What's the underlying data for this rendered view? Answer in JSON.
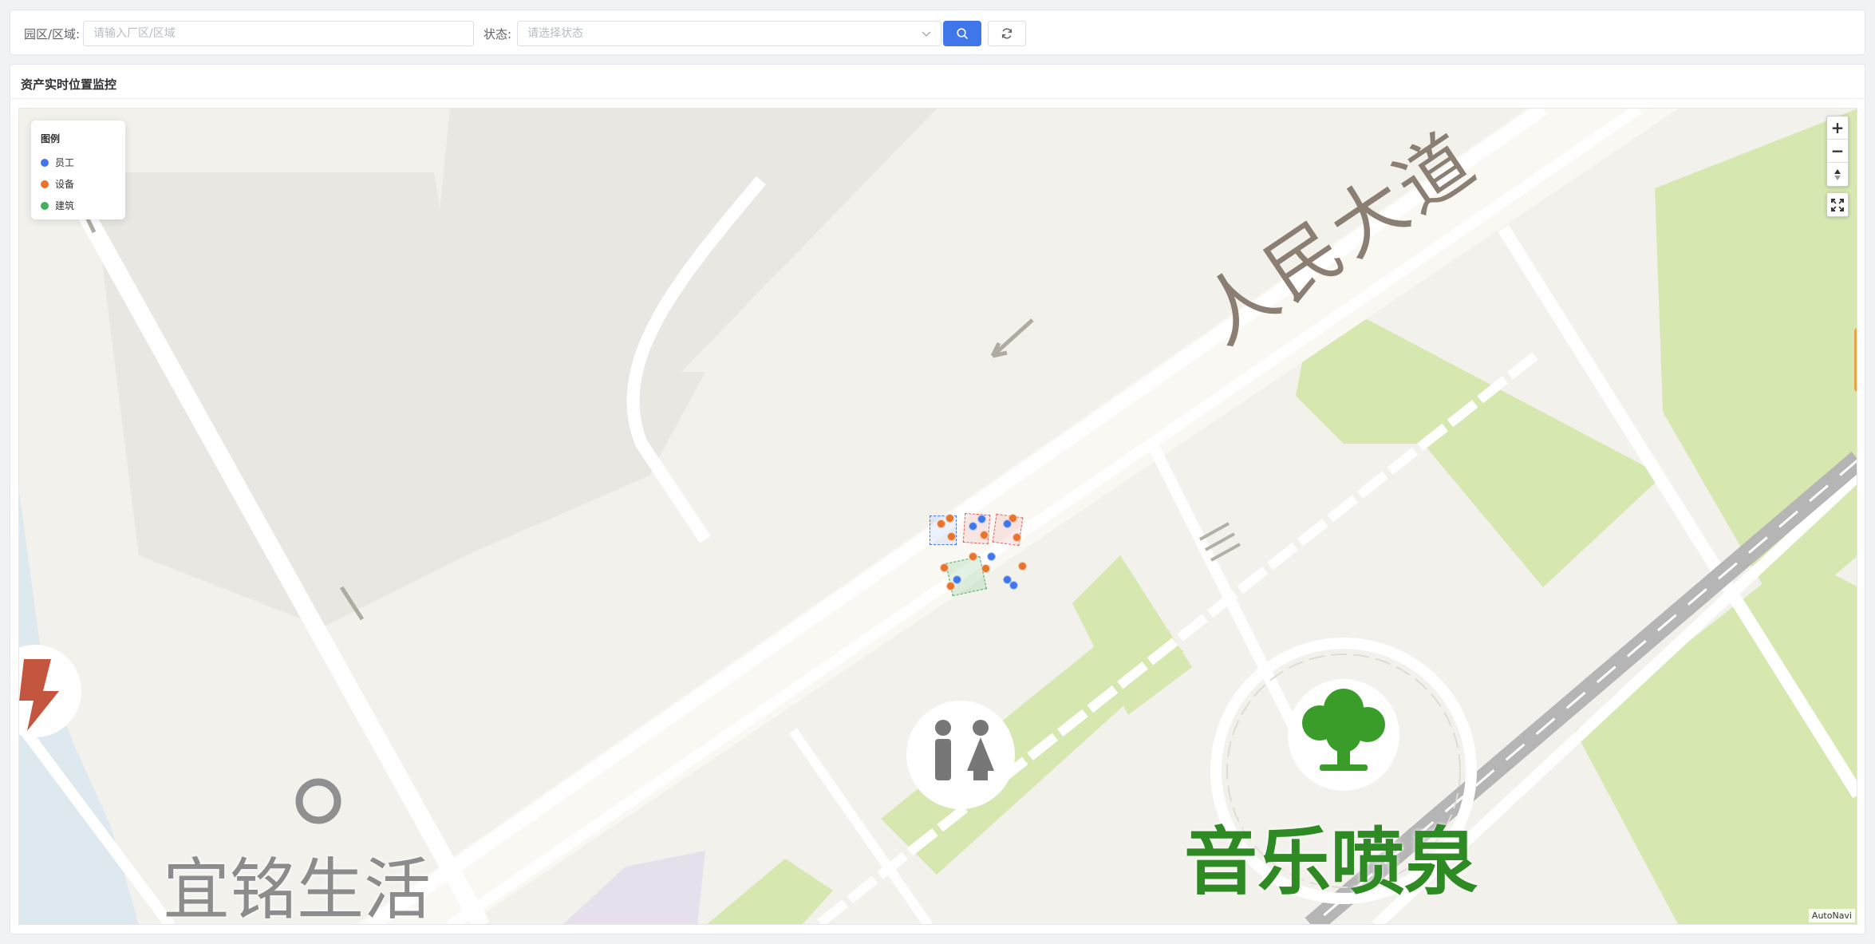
{
  "search": {
    "area_label": "园区/区域:",
    "area_placeholder": "请输入厂区/区域",
    "area_value": "",
    "status_label": "状态:",
    "status_placeholder": "请选择状态",
    "search_button_icon": "search-icon",
    "reset_button_icon": "refresh-icon"
  },
  "panel": {
    "title": "资产实时位置监控"
  },
  "legend": {
    "title": "图例",
    "items": [
      {
        "label": "员工",
        "color": "#3f76e9"
      },
      {
        "label": "设备",
        "color": "#e8732d"
      },
      {
        "label": "建筑",
        "color": "#43b05c"
      }
    ]
  },
  "map": {
    "controls": {
      "zoom_in": "+",
      "zoom_out": "−",
      "compass_icon": "compass-icon",
      "fullscreen_icon": "fullscreen-icon"
    },
    "labels": {
      "road": "人民大道",
      "fountain": "音乐喷泉",
      "shop": "宜铭生活"
    },
    "attribution": "AutoNavi",
    "colors": {
      "employee": "#3f76e9",
      "equipment": "#e8732d",
      "building": "#43b05c"
    }
  }
}
